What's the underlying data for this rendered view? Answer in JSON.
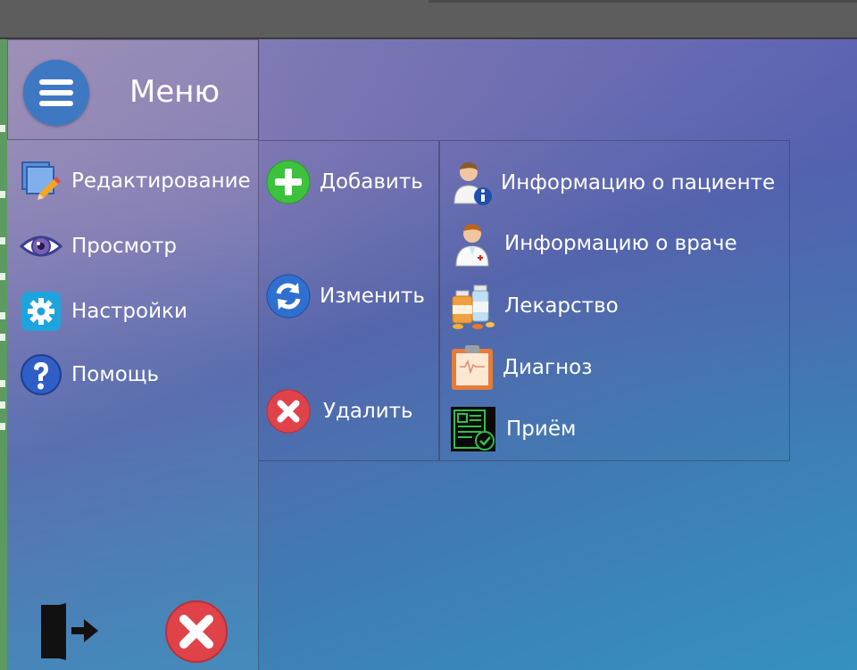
{
  "header": {
    "title": "Меню"
  },
  "sidebar": {
    "items": [
      {
        "label": "Редактирование",
        "icon": "edit-icon"
      },
      {
        "label": "Просмотр",
        "icon": "eye-icon"
      },
      {
        "label": "Настройки",
        "icon": "gear-icon"
      },
      {
        "label": "Помощь",
        "icon": "help-icon"
      }
    ],
    "footer": {
      "exit_icon": "exit-door-icon",
      "close_icon": "close-icon"
    }
  },
  "actions": {
    "items": [
      {
        "label": "Добавить",
        "icon": "plus-icon"
      },
      {
        "label": "Изменить",
        "icon": "refresh-icon"
      },
      {
        "label": "Удалить",
        "icon": "delete-icon"
      }
    ]
  },
  "entities": {
    "items": [
      {
        "label": "Информацию о пациенте",
        "icon": "patient-info-icon"
      },
      {
        "label": "Информацию о враче",
        "icon": "doctor-icon"
      },
      {
        "label": "Лекарство",
        "icon": "medicine-icon"
      },
      {
        "label": "Диагноз",
        "icon": "clipboard-icon"
      },
      {
        "label": "Приём",
        "icon": "appointment-icon"
      }
    ]
  },
  "colors": {
    "accent_blue": "#3f78c2",
    "add_green": "#3cc23c",
    "delete_red": "#e0424a"
  }
}
